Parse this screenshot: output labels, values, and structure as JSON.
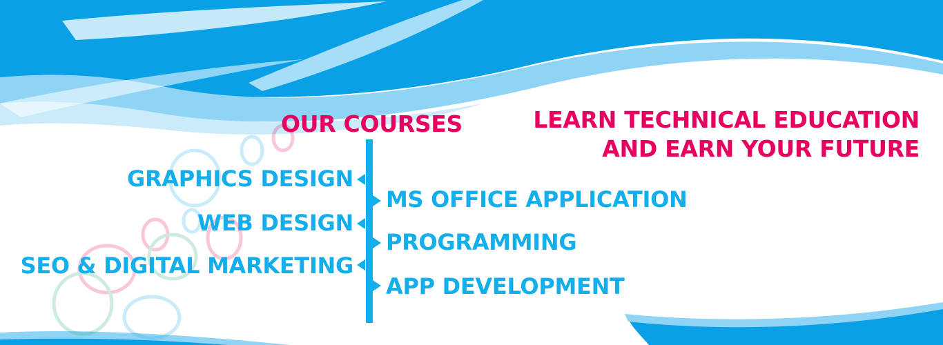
{
  "heading": {
    "courses_title": "OUR COURSES",
    "tagline_line1": "LEARN TECHNICAL EDUCATION",
    "tagline_line2": "AND  EARN YOUR FUTURE"
  },
  "courses": {
    "left": [
      "GRAPHICS DESIGN",
      "WEB DESIGN",
      "SEO & DIGITAL MARKETING"
    ],
    "right": [
      "MS OFFICE APPLICATION",
      "PROGRAMMING",
      "APP DEVELOPMENT"
    ]
  },
  "colors": {
    "accent_pink": "#e6005f",
    "course_blue": "#14aeea",
    "wave_blue": "#0aa0e6",
    "wave_light": "#8fd3f5"
  }
}
